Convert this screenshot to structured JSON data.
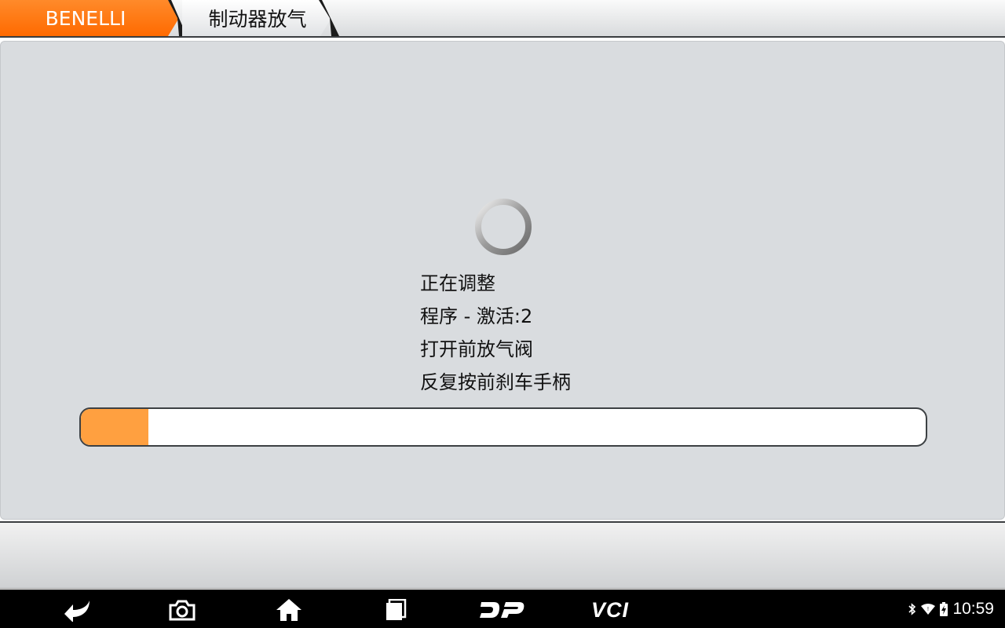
{
  "breadcrumb": {
    "brand": "BENELLI",
    "function": "制动器放气"
  },
  "status": {
    "lines": [
      "正在调整",
      "程序 - 激活:2",
      "打开前放气阀",
      "反复按前刹车手柄"
    ],
    "progress_fraction": 0.08
  },
  "navbar": {
    "vci_label": "VCI",
    "time": "10:59"
  },
  "colors": {
    "accent": "#ff6a00",
    "progress": "#ffa040",
    "panel": "#d9dcdf"
  },
  "icons": [
    "back-icon",
    "camera-icon",
    "home-icon",
    "recent-apps-icon",
    "dp-logo-icon",
    "bluetooth-icon",
    "wifi-icon",
    "battery-icon",
    "loading-spinner-icon"
  ]
}
